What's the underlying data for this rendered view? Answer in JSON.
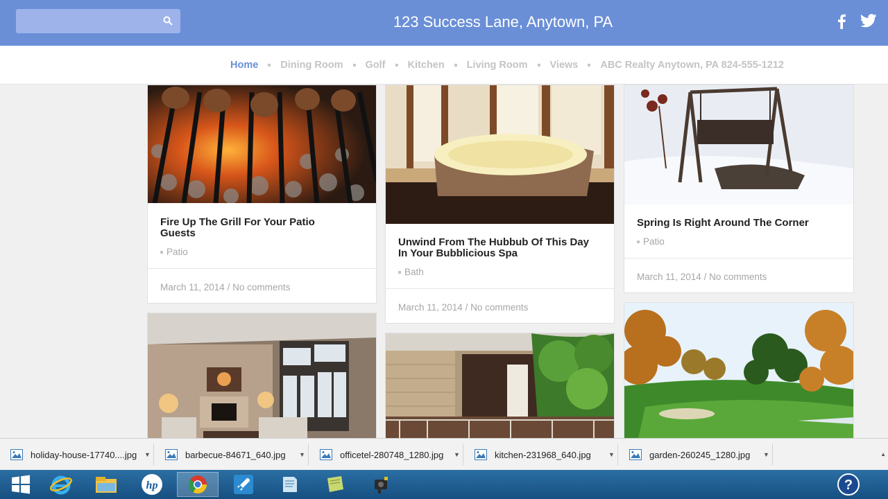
{
  "header": {
    "title": "123 Success Lane, Anytown, PA",
    "search_value": ""
  },
  "nav": {
    "items": [
      "Home",
      "Dining Room",
      "Golf",
      "Kitchen",
      "Living Room",
      "Views",
      "ABC Realty Anytown, PA 824-555-1212"
    ],
    "active": "Home"
  },
  "posts": [
    {
      "title_line1": "Fire Up The Grill For Your Patio",
      "title_line2": "Guests",
      "category": "Patio",
      "date": "March 11, 2014",
      "comments": "No comments",
      "image": "grill-photo"
    },
    {
      "title_line1": "Unwind From The Hubbub Of This Day",
      "title_line2": "In Your Bubblicious Spa",
      "category": "Bath",
      "date": "March 11, 2014",
      "comments": "No comments",
      "image": "hot-tub-photo"
    },
    {
      "title_line1": "Spring Is Right Around The Corner",
      "title_line2": "",
      "category": "Patio",
      "date": "March 11, 2014",
      "comments": "No comments",
      "image": "snowy-swing-photo"
    },
    {
      "image": "living-room-photo"
    },
    {
      "image": "patio-house-photo"
    },
    {
      "image": "golf-course-photo"
    }
  ],
  "downloads": [
    "holiday-house-17740....jpg",
    "barbecue-84671_640.jpg",
    "officetel-280748_1280.jpg",
    "kitchen-231968_640.jpg",
    "garden-260245_1280.jpg"
  ],
  "taskbar": {
    "apps": [
      "windows-start-icon",
      "internet-explorer-icon",
      "file-explorer-icon",
      "hp-icon",
      "chrome-icon",
      "rocket-icon",
      "notepad-icon",
      "sticky-notes-icon",
      "camera-app-icon"
    ],
    "active": "chrome-icon"
  },
  "colors": {
    "accent": "#6a8fd7",
    "text_muted": "#a6a6a6"
  }
}
